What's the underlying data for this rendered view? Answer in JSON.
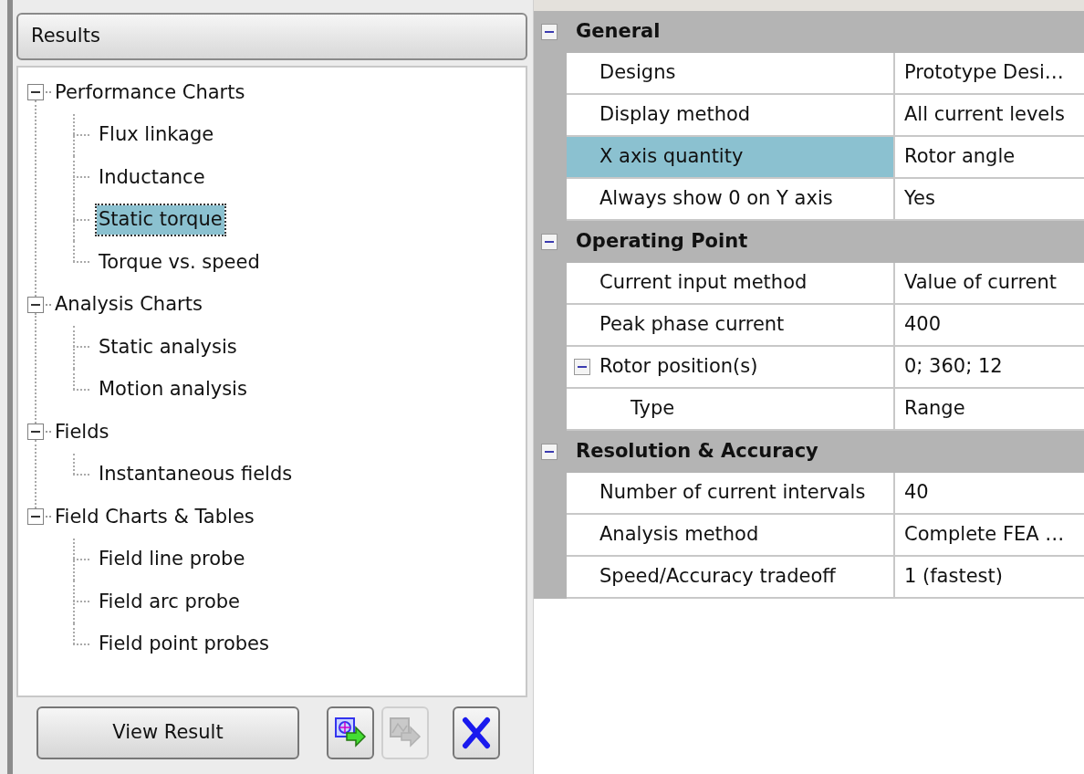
{
  "results_panel": {
    "title": "Results",
    "tree": [
      {
        "label": "Performance Charts",
        "expanded": true,
        "children": [
          {
            "label": "Flux linkage",
            "selected": false
          },
          {
            "label": "Inductance",
            "selected": false
          },
          {
            "label": "Static torque",
            "selected": true
          },
          {
            "label": "Torque vs. speed",
            "selected": false
          }
        ]
      },
      {
        "label": "Analysis Charts",
        "expanded": true,
        "children": [
          {
            "label": "Static analysis",
            "selected": false
          },
          {
            "label": "Motion analysis",
            "selected": false
          }
        ]
      },
      {
        "label": "Fields",
        "expanded": true,
        "children": [
          {
            "label": "Instantaneous fields",
            "selected": false
          }
        ]
      },
      {
        "label": "Field Charts & Tables",
        "expanded": true,
        "children": [
          {
            "label": "Field line probe",
            "selected": false
          },
          {
            "label": "Field arc probe",
            "selected": false
          },
          {
            "label": "Field point probes",
            "selected": false
          }
        ]
      }
    ],
    "view_button": "View Result",
    "icon_buttons": [
      {
        "kind": "add",
        "disabled": false
      },
      {
        "kind": "move",
        "disabled": true
      },
      {
        "kind": "delete",
        "disabled": false
      }
    ]
  },
  "properties": [
    {
      "title": "General",
      "expanded": true,
      "rows": [
        {
          "label": "Designs",
          "value": "Prototype Desi…",
          "selected": false
        },
        {
          "label": "Display method",
          "value": "All current levels",
          "selected": false
        },
        {
          "label": "X axis quantity",
          "value": "Rotor angle",
          "selected": true
        },
        {
          "label": "Always show 0 on Y axis",
          "value": "Yes",
          "selected": false
        }
      ]
    },
    {
      "title": "Operating Point",
      "expanded": true,
      "rows": [
        {
          "label": "Current input method",
          "value": "Value of current",
          "selected": false
        },
        {
          "label": "Peak phase current",
          "value": "400",
          "selected": false
        },
        {
          "label": "Rotor position(s)",
          "value": "0; 360; 12",
          "selected": false,
          "expanded": true,
          "children": [
            {
              "label": "Type",
              "value": "Range",
              "selected": false
            }
          ]
        }
      ]
    },
    {
      "title": "Resolution & Accuracy",
      "expanded": true,
      "rows": [
        {
          "label": "Number of current intervals",
          "value": "40",
          "selected": false
        },
        {
          "label": "Analysis method",
          "value": "Complete FEA …",
          "selected": false
        },
        {
          "label": "Speed/Accuracy tradeoff",
          "value": "1 (fastest)",
          "selected": false
        }
      ]
    }
  ]
}
